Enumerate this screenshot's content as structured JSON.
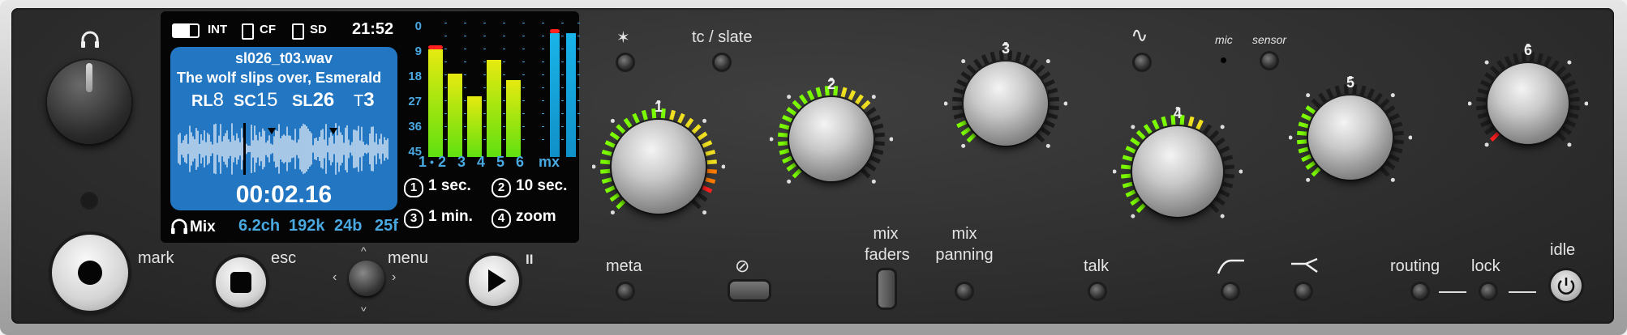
{
  "status": {
    "batt": "INT",
    "cf": "CF",
    "sd": "SD",
    "time": "21:52"
  },
  "take": {
    "file": "sl026_t03.wav",
    "note": "The wolf slips over, Esmerald",
    "rl_label": "RL",
    "rl": "8",
    "sc_label": "SC",
    "sc": "15",
    "sl_label": "SL",
    "sl": "26",
    "t_label": "T",
    "t": "3",
    "timecode": "00:02.16"
  },
  "format": {
    "mix": "Mix",
    "channels": "6.2ch",
    "rate": "192k",
    "bits": "24b",
    "fps": "25f"
  },
  "meter_scale": [
    "0",
    "9",
    "18",
    "27",
    "36",
    "45"
  ],
  "meters": [
    {
      "label": "1",
      "level": 0.8,
      "peak": true
    },
    {
      "label": "2",
      "level": 0.62,
      "peak": false
    },
    {
      "label": "3",
      "level": 0.45,
      "peak": false
    },
    {
      "label": "4",
      "level": 0.72,
      "peak": false
    },
    {
      "label": "5",
      "level": 0.57,
      "peak": false
    },
    {
      "label": "6",
      "level": 0,
      "peak": false
    },
    {
      "label": "mx",
      "level": 0.92,
      "peak": true
    },
    {
      "label": "",
      "level": 0.92,
      "peak": false
    }
  ],
  "meter_dot": "•",
  "softkeys": [
    {
      "num": "1",
      "text": "1 sec."
    },
    {
      "num": "2",
      "text": "10 sec."
    },
    {
      "num": "3",
      "text": "1 min."
    },
    {
      "num": "4",
      "text": "zoom"
    }
  ],
  "knobs": [
    {
      "label": "1",
      "level": 0.95
    },
    {
      "label": "2",
      "level": 0.7
    },
    {
      "label": "3",
      "level": 0.1
    },
    {
      "label": "4",
      "level": 0.6
    },
    {
      "label": "5",
      "level": 0.3
    },
    {
      "label": "6",
      "level": 0.0
    }
  ],
  "labels": {
    "star": "✶",
    "tc_slate": "tc / slate",
    "tilde": "∿",
    "mic": "mic",
    "sensor": "sensor",
    "mark": "mark",
    "esc": "esc",
    "menu": "menu",
    "pause": "II",
    "meta": "meta",
    "phase": "⊘",
    "mix_faders_1": "mix",
    "mix_faders_2": "faders",
    "mix_panning_1": "mix",
    "mix_panning_2": "panning",
    "talk": "talk",
    "routing": "routing",
    "lock": "lock",
    "idle": "idle"
  },
  "colors": {
    "screen_blue": "#2276c2",
    "meter_text": "#4aa8e0",
    "led_green": "#7cfc00",
    "led_yellow": "#f0e020",
    "led_red": "#ff2020"
  }
}
